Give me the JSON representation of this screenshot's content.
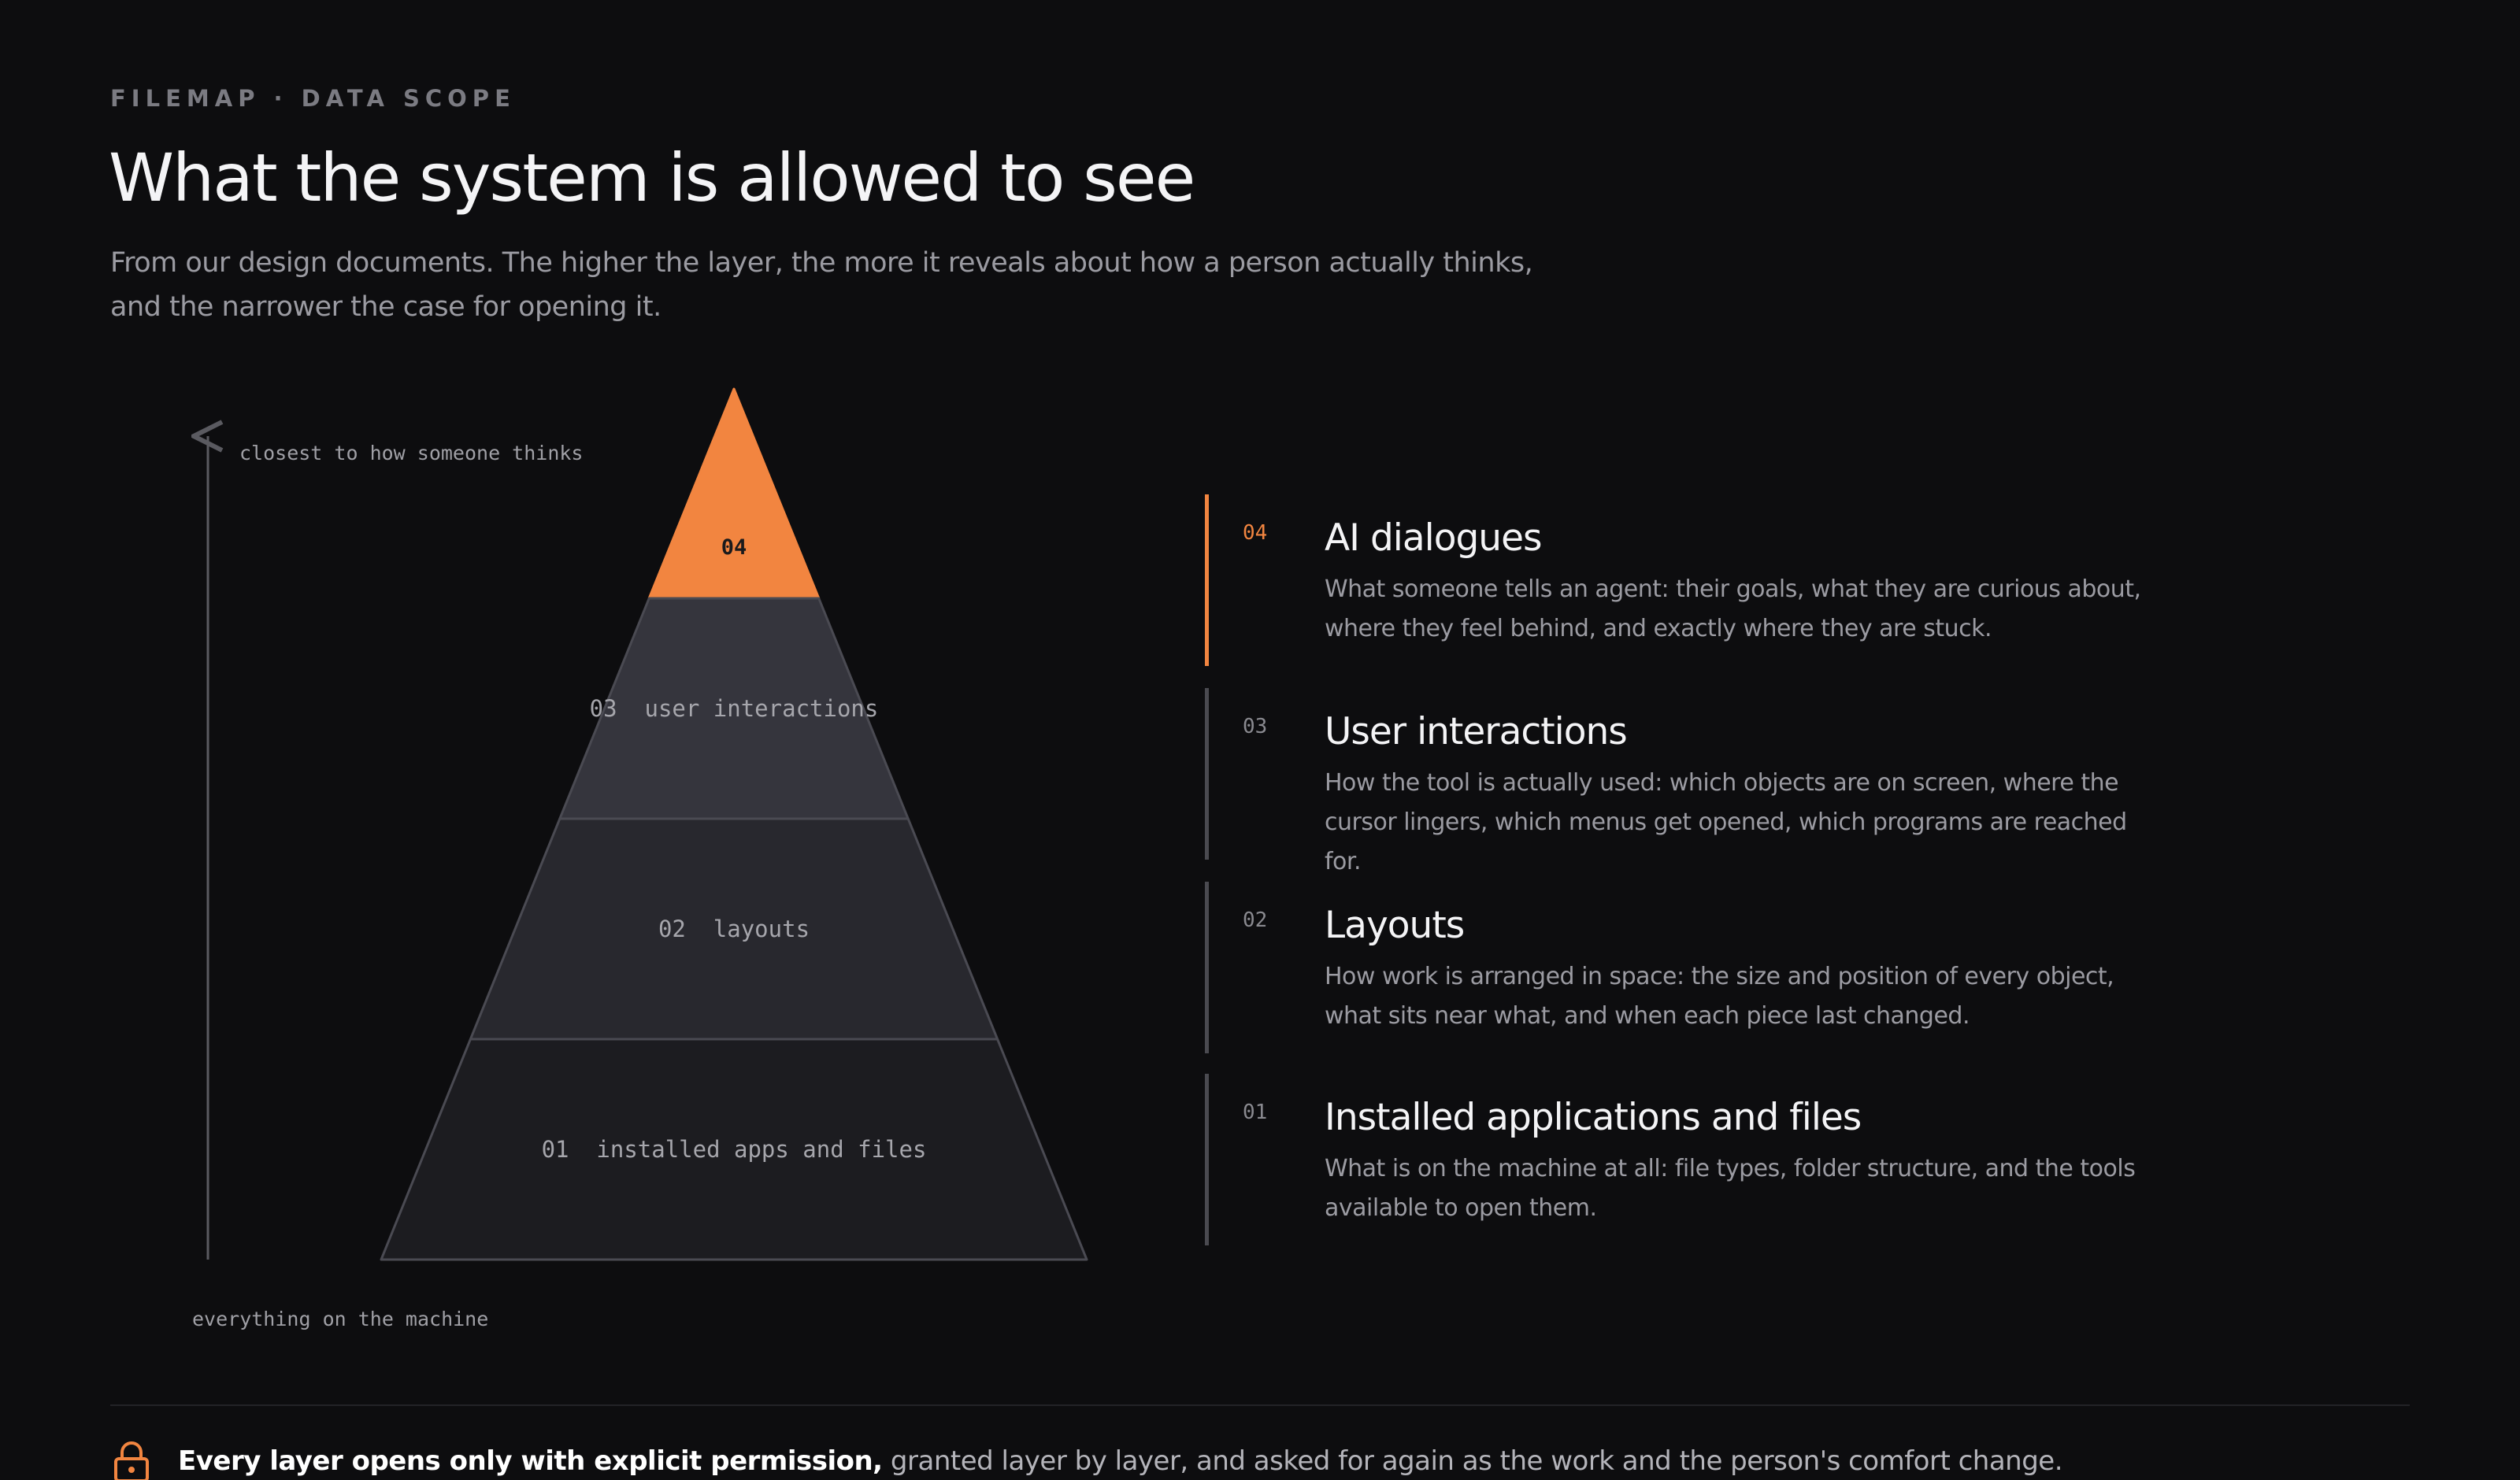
{
  "header": {
    "eyebrow": "FILEMAP · DATA SCOPE",
    "title": "What the system is allowed to see",
    "subtitle": "From our design documents. The higher the layer, the more it reveals about how a person actually thinks, and the narrower the case for opening it."
  },
  "pyramid": {
    "axis_top_label": "closest to how someone thinks",
    "axis_bottom_label": "everything on the machine",
    "levels": [
      {
        "number": "04",
        "label": "",
        "fill": "#f28540",
        "active": true
      },
      {
        "number": "03",
        "label": "user interactions",
        "fill": "#35353d",
        "active": false
      },
      {
        "number": "02",
        "label": "layouts",
        "fill": "#28282e",
        "active": false
      },
      {
        "number": "01",
        "label": "installed apps and files",
        "fill": "#1c1c20",
        "active": false
      }
    ]
  },
  "layers": [
    {
      "number": "04",
      "name": "AI dialogues",
      "description": "What someone tells an agent: their goals, what they are curious about, where they feel behind, and exactly where they are stuck."
    },
    {
      "number": "03",
      "name": "User interactions",
      "description": "How the tool is actually used: which objects are on screen, where the cursor lingers, which menus get opened, which programs are reached for."
    },
    {
      "number": "02",
      "name": "Layouts",
      "description": "How work is arranged in space: the size and position of every object, what sits near what, and when each piece last changed."
    },
    {
      "number": "01",
      "name": "Installed applications and files",
      "description": "What is on the machine at all: file types, folder structure, and the tools available to open them."
    }
  ],
  "footer": {
    "icon": "lock-icon",
    "bold_text": "Every layer opens only with explicit permission,",
    "text": " granted layer by layer, and asked for again as the work and the person's comfort change."
  },
  "colors": {
    "accent": "#f28540",
    "background": "#0d0d0f",
    "muted_bar": "#4a4a50"
  }
}
